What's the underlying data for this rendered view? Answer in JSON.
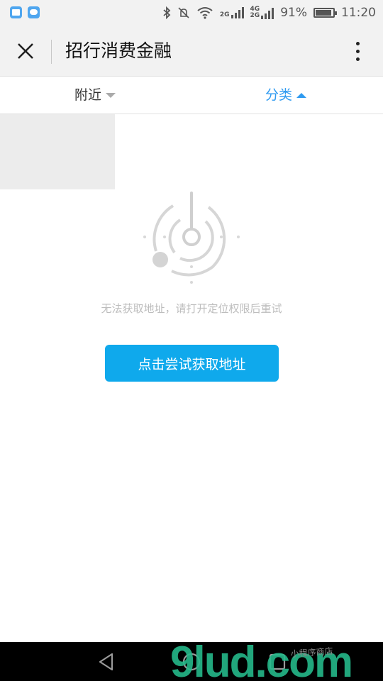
{
  "status_bar": {
    "icons": [
      "gallery-notification-icon",
      "message-notification-icon",
      "bluetooth-icon",
      "mute-icon",
      "wifi-icon"
    ],
    "network_top": "2G",
    "network_dual_top": "4G",
    "network_dual_bottom": "2G",
    "battery_percent": "91%",
    "battery_level": 0.91,
    "time": "11:20"
  },
  "titlebar": {
    "title": "招行消费金融",
    "icons": [
      "close-icon",
      "more-vertical-icon"
    ]
  },
  "tabs": [
    {
      "label": "附近",
      "state": "collapsed"
    },
    {
      "label": "分类",
      "state": "expanded",
      "color": "#2e9af0"
    }
  ],
  "main": {
    "empty_icon": "radar-location-icon",
    "message": "无法获取地址，请打开定位权限后重试",
    "retry_button": "点击尝试获取地址",
    "accent_color": "#0fa9ec"
  },
  "navbar": {
    "icons": [
      "back-icon",
      "home-icon",
      "recent-apps-icon"
    ]
  },
  "watermark": {
    "text": "9lud.com",
    "small_text": "小程序商店"
  }
}
